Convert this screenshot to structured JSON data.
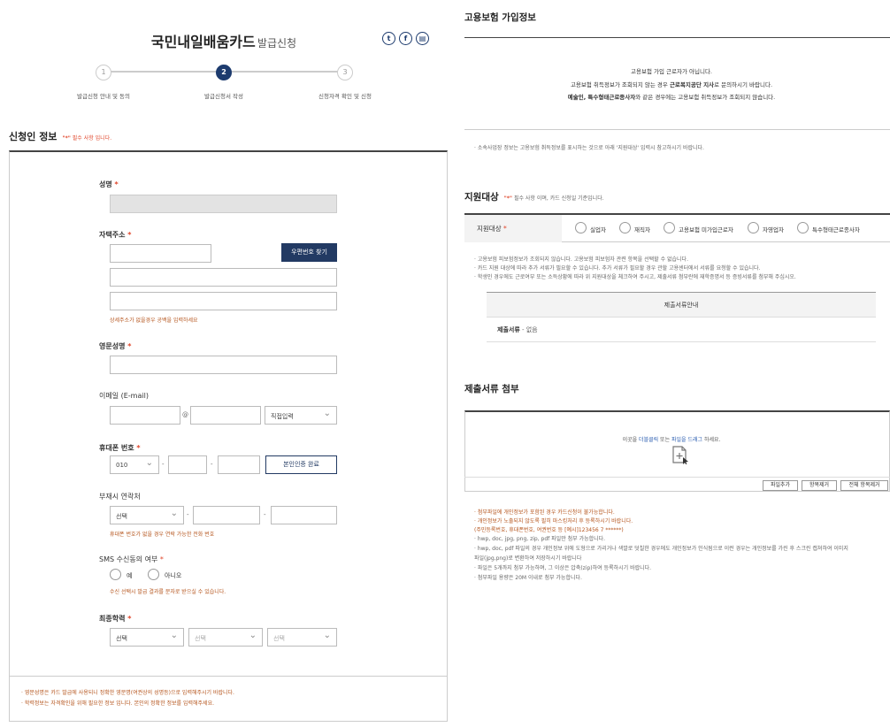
{
  "header": {
    "title": "국민내일배움카드",
    "title_suffix": "발급신청",
    "share_icons": [
      "twitter-icon",
      "facebook-icon",
      "print-icon"
    ]
  },
  "steps": [
    {
      "num": "1",
      "label": "발급신청 안내 및 동의"
    },
    {
      "num": "2",
      "label": "발급신청서 작성"
    },
    {
      "num": "3",
      "label": "신청자격 확인 및 신청"
    }
  ],
  "applicant": {
    "section_title": "신청인 정보",
    "required_note_mark": "\"*\"",
    "required_note": "필수 사항 입니다.",
    "name_label": "성명",
    "address_label": "자택주소",
    "postcode_button": "우편번호 찾기",
    "address_hint": "상세주소가 없을경우 공백을 입력하세요",
    "english_name_label": "영문성명",
    "email_label": "이메일 (E-mail)",
    "email_at": "@",
    "email_domain_select": "직접입력",
    "phone_label": "휴대폰 번호",
    "phone_prefix": "010",
    "phone_verify_button": "본인인증 완료",
    "alt_contact_label": "부재시 연락처",
    "alt_contact_select": "선택",
    "alt_contact_hint": "휴대폰 번호가 없을 경우 연락 가능한 전화 번호",
    "sms_label": "SMS 수신동의 여부",
    "sms_yes": "예",
    "sms_no": "아니오",
    "sms_hint": "수신 선택시 발급 결과를 문자로 받으실 수 있습니다.",
    "education_label": "최종학력",
    "edu_select1": "선택",
    "edu_select2": "선택",
    "edu_select3": "선택",
    "footnote1": "· 영문성명은 카드 발급에 사용되니 정확한 영문명(여권상의 성명등)으로 입력해주시기 바랍니다.",
    "footnote2": "· 학력정보는 자격확인을 위해 필요한 정보 입니다. 본인의 정확한 정보를 입력해주세요."
  },
  "insurance": {
    "title": "고용보험 가입정보",
    "line1": "고용보험 가입 근로자가 아닙니다.",
    "line2_pre": "고용보험 취득정보가 조회되지 않는 경우 ",
    "line2_bold": "근로복지공단 지사",
    "line2_post": "로 문의하시기 바랍니다.",
    "line3_bold": "예술인, 특수형태근로종사자",
    "line3_post": "와 같은 경우에는 고용보험 취득정보가 조회되지 않습니다.",
    "note": "· 소속사업장 정보는 고용보험 취득정보를 표시하는 것으로 아래 '지원대상' 입력시 참고하시기 바랍니다."
  },
  "support": {
    "title": "지원대상",
    "required_mark": "\"*\"",
    "required_note": "필수 사항 이며, 카드 신청일 기준입니다.",
    "label": "지원대상",
    "options": [
      "실업자",
      "재직자",
      "고용보험 미가입근로자",
      "자영업자",
      "특수형태근로종사자"
    ],
    "note1": "· 고용보험 피보험정보가 조회되지 않습니다. 고용보험 피보험자 관련 항목을 선택할 수 없습니다.",
    "note2": "· 카드 지원 대상에 따라 추가 서류가 필요할 수 있습니다. 추가 서류가 필요할 경우 관할 고용센터에서 서류를 요청할 수 있습니다.",
    "note3": "· 학생인 경우에도 근로여부 또는 소득상황에 따라 위 지원대상을 체크하여 주시고, 제출서류 첨부란에 재학증명서 등 증빙서류를 첨부해 주십시오.",
    "doc_header": "제출서류안내",
    "doc_row_label": "제출서류",
    "doc_row_value": " - 없음"
  },
  "attach": {
    "title": "제출서류 첨부",
    "drop_pre": "이곳을 ",
    "drop_link1": "더블클릭",
    "drop_mid": " 또는 ",
    "drop_link2": "파일을 드래그",
    "drop_post": " 하세요.",
    "btn_add": "파일추가",
    "btn_remove": "항목제거",
    "btn_remove_all": "전체 항목제거",
    "notes_orange": [
      "· 첨부파일에 개인정보가 포함된 경우 카드신청이 불가능합니다.",
      "· 개인정보가 노출되지 않도록 필히 마스킹처리 후 등록하시기 바랍니다.",
      "  (주민등록번호, 휴대폰번호, 여권번호 등 [예시]123456 7 ******)"
    ],
    "notes_gray": [
      "· hwp, doc, jpg, png, zip, pdf 파일만 첨부 가능합니다.",
      "· hwp, doc, pdf 파일의 경우 개인정보 위에 도형으로 가리거나 색깔로 덧칠한 경우에도 개인정보가 인식됨으로 이런 경우는 개인정보를 가린 후 스크린 캡쳐하여 이미지",
      "  파일(jpg,png)로 변환하여 저장하시기 바랍니다",
      "· 파일은 5개까지 첨부 가능하며, 그 이상은 압축(zip)하여 등록하시기 바랍니다.",
      "· 첨부파일 용량은 20M 이내로 첨부 가능합니다."
    ]
  }
}
